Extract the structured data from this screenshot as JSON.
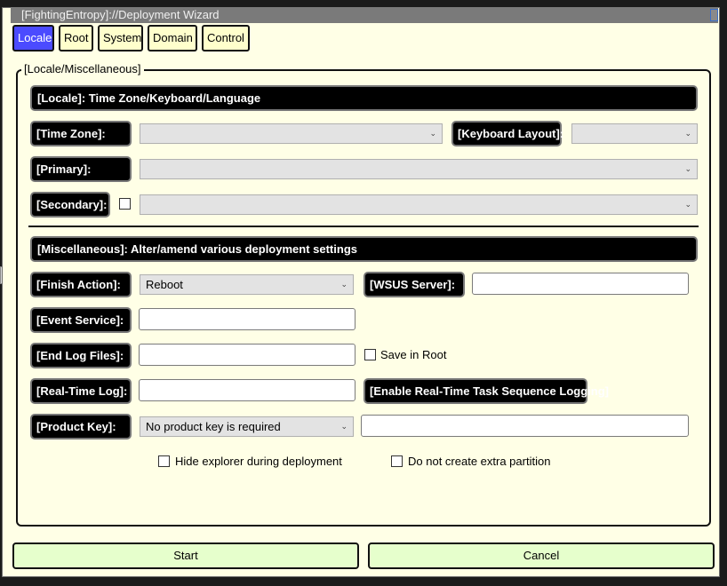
{
  "window": {
    "title": "[FightingEntropy]://Deployment Wizard"
  },
  "tabs": [
    {
      "label": "Locale",
      "active": true
    },
    {
      "label": "Root"
    },
    {
      "label": "System"
    },
    {
      "label": "Domain"
    },
    {
      "label": "Control"
    }
  ],
  "group": {
    "title": "[Locale/Miscellaneous]",
    "locale_header": "[Locale]: Time Zone/Keyboard/Language",
    "misc_header": "[Miscellaneous]: Alter/amend various deployment settings"
  },
  "locale": {
    "time_zone_label": "[Time Zone]:",
    "time_zone_value": "",
    "keyboard_layout_label": "[Keyboard Layout]:",
    "keyboard_layout_value": "",
    "primary_label": "[Primary]:",
    "primary_value": "",
    "secondary_label": "[Secondary]:",
    "secondary_checked": false,
    "secondary_value": ""
  },
  "misc": {
    "finish_action_label": "[Finish Action]:",
    "finish_action_value": "Reboot",
    "wsus_server_label": "[WSUS Server]:",
    "wsus_server_value": "",
    "event_service_label": "[Event Service]:",
    "event_service_value": "",
    "end_log_files_label": "[End Log Files]:",
    "end_log_files_value": "",
    "save_in_root_label": "Save in Root",
    "save_in_root_checked": false,
    "realtime_log_label": "[Real-Time Log]:",
    "realtime_log_value": "",
    "enable_realtime_label": "[Enable Real-Time Task Sequence Logging]",
    "product_key_label": "[Product Key]:",
    "product_key_mode": "No product key is required",
    "product_key_value": "",
    "hide_explorer_label": "Hide explorer during deployment",
    "hide_explorer_checked": false,
    "no_extra_partition_label": "Do not create extra partition",
    "no_extra_partition_checked": false
  },
  "buttons": {
    "start": "Start",
    "cancel": "Cancel"
  },
  "colors": {
    "active_tab": "#4b4bff",
    "panel_bg": "#ffffe6",
    "header_bg": "#000000",
    "button_bg": "#e6ffcc"
  }
}
